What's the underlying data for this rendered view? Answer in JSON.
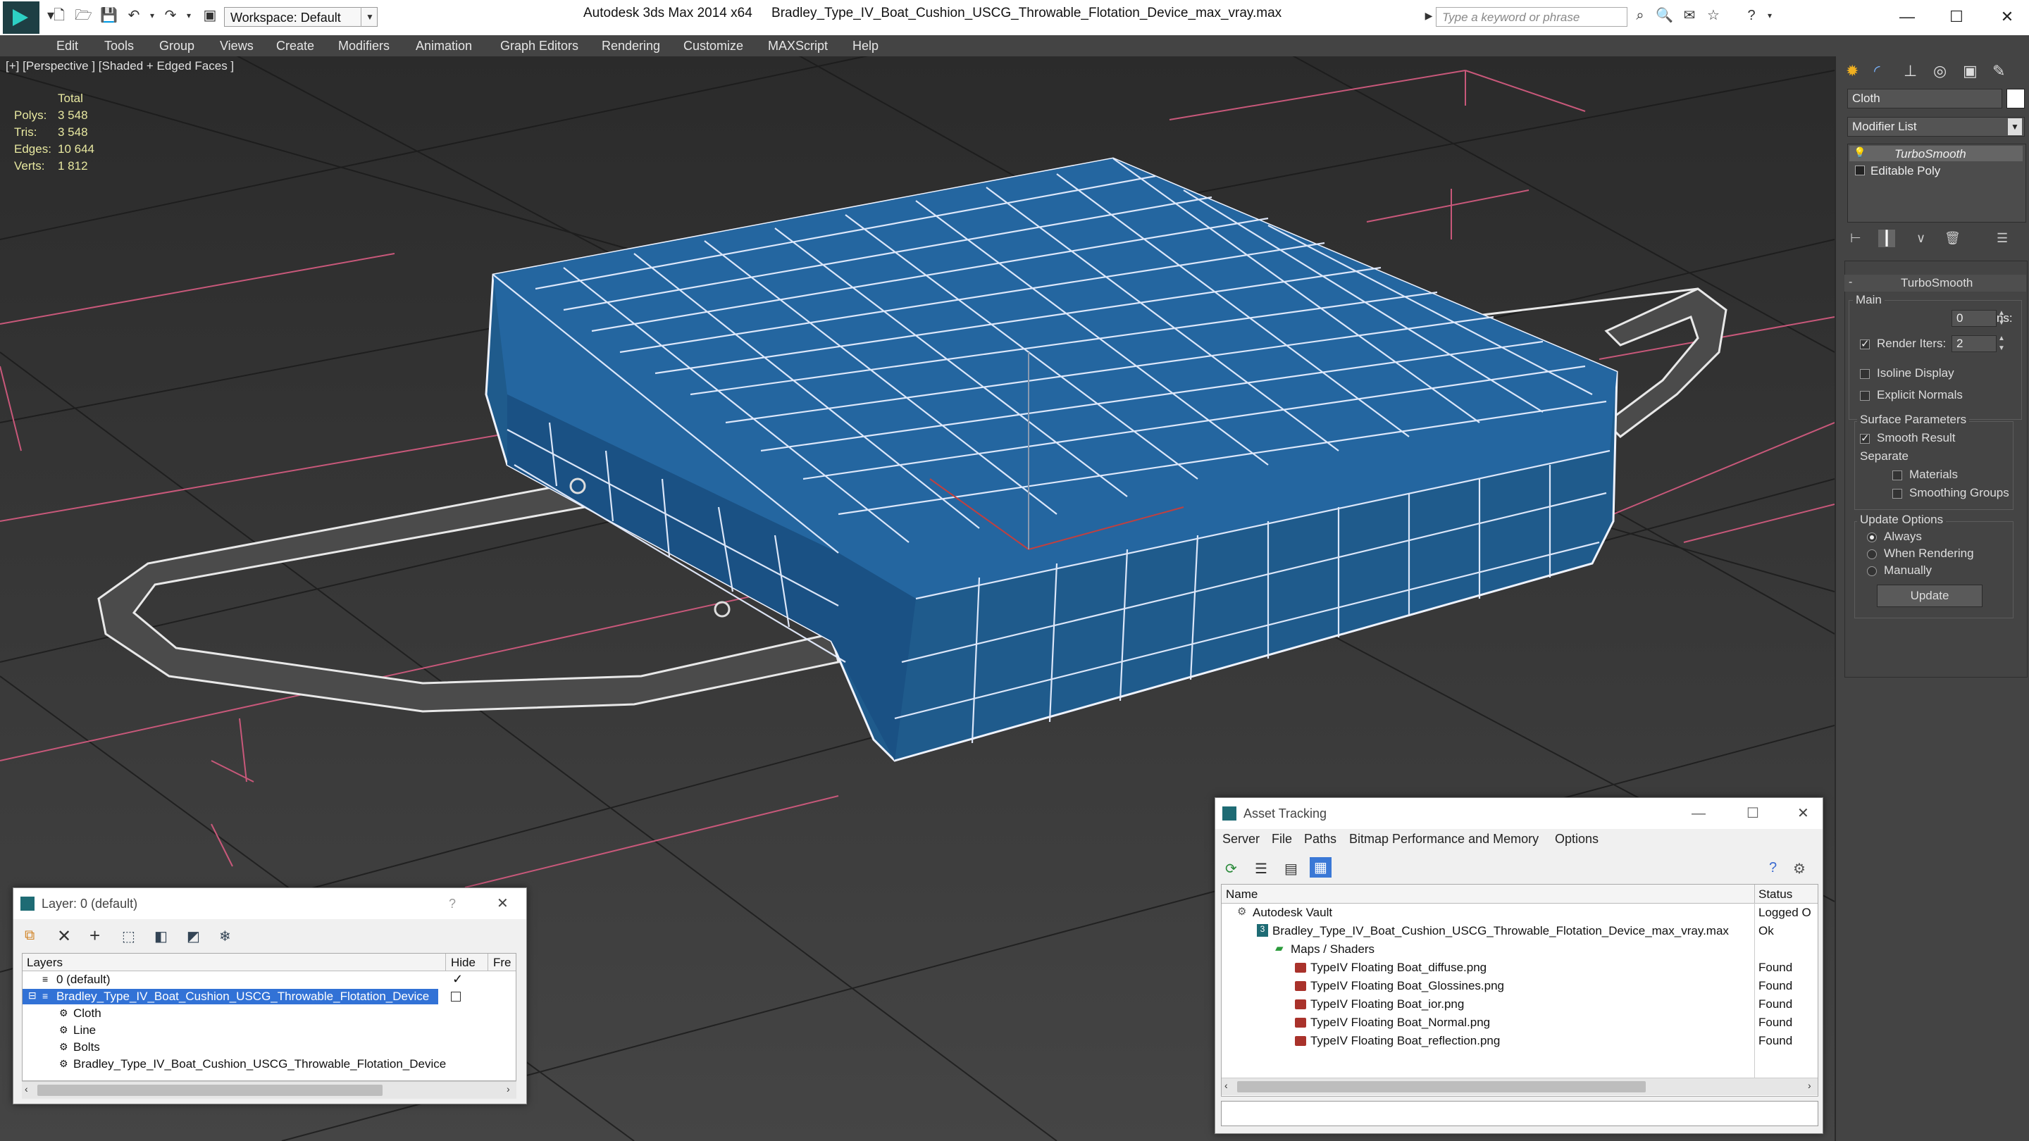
{
  "app": {
    "title_app": "Autodesk 3ds Max  2014 x64",
    "title_file": "Bradley_Type_IV_Boat_Cushion_USCG_Throwable_Flotation_Device_max_vray.max",
    "workspace": "Workspace: Default",
    "search_placeholder": "Type a keyword or phrase"
  },
  "menu": [
    "Edit",
    "Tools",
    "Group",
    "Views",
    "Create",
    "Modifiers",
    "Animation",
    "Graph Editors",
    "Rendering",
    "Customize",
    "MAXScript",
    "Help"
  ],
  "viewport": {
    "label": "[+] [Perspective ] [Shaded + Edged Faces ]",
    "stats_header": "Total",
    "stats": [
      {
        "label": "Polys:",
        "value": "3 548"
      },
      {
        "label": "Tris:",
        "value": "3 548"
      },
      {
        "label": "Edges:",
        "value": "10 644"
      },
      {
        "label": "Verts:",
        "value": "1 812"
      }
    ]
  },
  "command_panel": {
    "object_name": "Cloth",
    "modifier_list": "Modifier List",
    "stack": [
      "TurboSmooth",
      "Editable Poly"
    ],
    "rollout_title": "TurboSmooth",
    "main_label": "Main",
    "iterations_label": "Iterations:",
    "iterations_value": "0",
    "render_iters_label": "Render Iters:",
    "render_iters_value": "2",
    "isoline": "Isoline Display",
    "explicit_normals": "Explicit Normals",
    "surface_params": "Surface Parameters",
    "smooth_result": "Smooth Result",
    "separate": "Separate",
    "materials": "Materials",
    "smoothing_groups": "Smoothing Groups",
    "update_options": "Update Options",
    "always": "Always",
    "when_rendering": "When Rendering",
    "manually": "Manually",
    "update_button": "Update"
  },
  "layer_dialog": {
    "title": "Layer: 0 (default)",
    "help": "?",
    "col_layers": "Layers",
    "col_hide": "Hide",
    "col_freeze": "Fre",
    "rows": [
      {
        "name": "0 (default)"
      },
      {
        "name": "Bradley_Type_IV_Boat_Cushion_USCG_Throwable_Flotation_Device"
      },
      {
        "name": "Cloth"
      },
      {
        "name": "Line"
      },
      {
        "name": "Bolts"
      },
      {
        "name": "Bradley_Type_IV_Boat_Cushion_USCG_Throwable_Flotation_Device"
      }
    ]
  },
  "asset_dialog": {
    "title": "Asset Tracking",
    "menu": [
      "Server",
      "File",
      "Paths",
      "Bitmap Performance and Memory",
      "Options"
    ],
    "col_name": "Name",
    "col_status": "Status",
    "rows": [
      {
        "name": "Autodesk Vault",
        "status": "Logged O"
      },
      {
        "name": "Bradley_Type_IV_Boat_Cushion_USCG_Throwable_Flotation_Device_max_vray.max",
        "status": "Ok"
      },
      {
        "name": "Maps / Shaders",
        "status": ""
      },
      {
        "name": "TypeIV Floating Boat_diffuse.png",
        "status": "Found"
      },
      {
        "name": "TypeIV Floating Boat_Glossines.png",
        "status": "Found"
      },
      {
        "name": "TypeIV Floating Boat_ior.png",
        "status": "Found"
      },
      {
        "name": "TypeIV Floating Boat_Normal.png",
        "status": "Found"
      },
      {
        "name": "TypeIV Floating Boat_reflection.png",
        "status": "Found"
      }
    ]
  }
}
